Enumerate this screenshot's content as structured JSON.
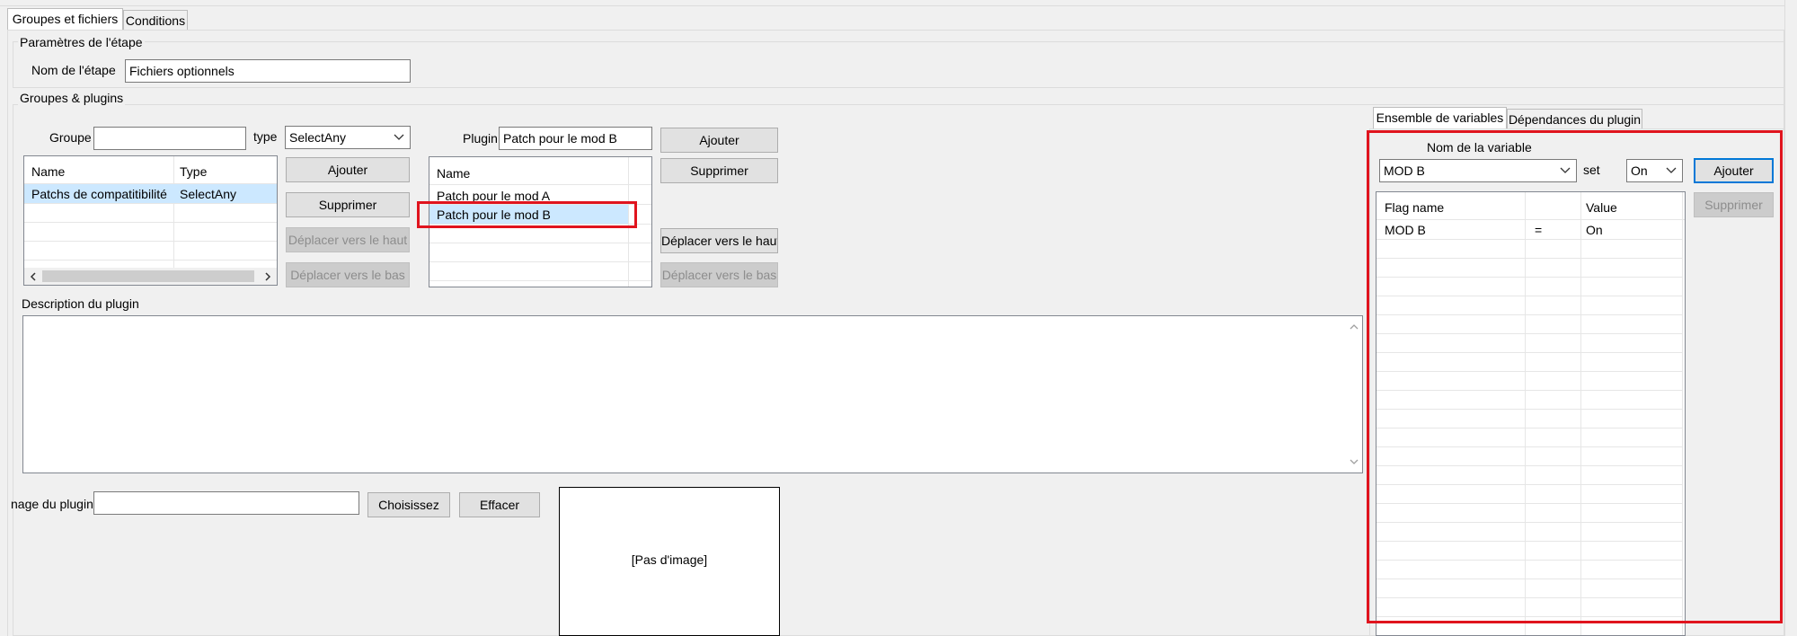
{
  "tabs": {
    "groups_files": "Groupes et fichiers",
    "conditions": "Conditions"
  },
  "step": {
    "section_title": "Paramètres de l'étape",
    "name_label": "Nom de l'étape",
    "name_value": "Fichiers optionnels"
  },
  "groups_plugins": {
    "section_title": "Groupes & plugins",
    "group_label": "Groupe",
    "group_value": "",
    "type_label": "type",
    "type_value": "SelectAny",
    "plugin_label": "Plugin",
    "plugin_value": "Patch pour le mod B",
    "groups_table": {
      "headers": [
        "Name",
        "Type"
      ],
      "rows": [
        {
          "name": "Patchs de compatitibilité",
          "type": "SelectAny"
        }
      ]
    },
    "group_buttons": {
      "add": "Ajouter",
      "remove": "Supprimer",
      "move_up": "Déplacer vers le haut",
      "move_down": "Déplacer vers le bas"
    },
    "plugins_table": {
      "header": "Name",
      "rows": [
        "Patch pour le mod A",
        "Patch pour le mod B"
      ]
    },
    "plugin_buttons": {
      "add": "Ajouter",
      "remove": "Supprimer",
      "move_up": "Déplacer vers le haut",
      "move_down": "Déplacer vers le bas"
    }
  },
  "description": {
    "label": "Description du plugin",
    "value": ""
  },
  "image": {
    "label": "nage du plugin",
    "path_value": "",
    "choose": "Choisissez",
    "clear": "Effacer",
    "placeholder": "[Pas d'image]"
  },
  "right_panel": {
    "tabs": {
      "variables": "Ensemble de variables",
      "dependencies": "Dépendances du plugin"
    },
    "variable_name_label": "Nom de la variable",
    "variable_value": "MOD B",
    "set_label": "set",
    "set_value": "On",
    "add_button": "Ajouter",
    "remove_button": "Supprimer",
    "flags_table": {
      "headers": [
        "Flag name",
        "",
        "Value"
      ],
      "rows": [
        {
          "flag": "MOD B",
          "op": "=",
          "value": "On"
        }
      ]
    }
  },
  "colors": {
    "highlight_red": "#e0141e",
    "selection_blue": "#cce8ff",
    "focus_blue": "#0078d7"
  }
}
